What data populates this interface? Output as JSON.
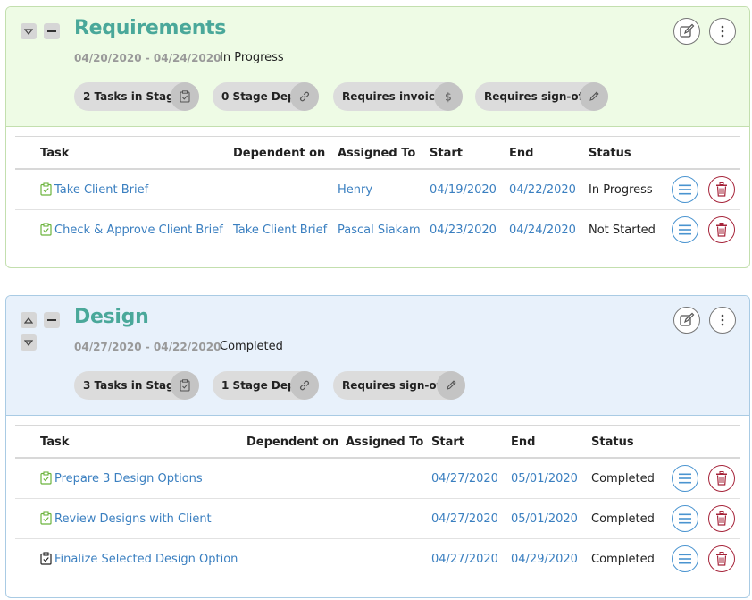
{
  "stages": [
    {
      "title": "Requirements",
      "dates": "04/20/2020 - 04/24/2020",
      "status": "In Progress",
      "pills": [
        {
          "count": "2",
          "label": "Tasks in Stage",
          "icon": "clipboard-check-icon"
        },
        {
          "count": "0",
          "label": "Stage Dep",
          "icon": "link-icon"
        },
        {
          "count": "",
          "label": "Requires invoice",
          "icon": "dollar-icon"
        },
        {
          "count": "",
          "label": "Requires sign-off",
          "icon": "pencil-icon"
        }
      ],
      "columns": [
        "Task",
        "Dependent on",
        "Assigned To",
        "Start",
        "End",
        "Status"
      ],
      "rows": [
        {
          "task": "Take Client Brief",
          "dependent": "",
          "assigned": "Henry",
          "start": "04/19/2020",
          "end": "04/22/2020",
          "status": "In Progress",
          "check_color": "#6bb33c"
        },
        {
          "task": "Check & Approve Client Brief",
          "dependent": "Take Client Brief",
          "assigned": "Pascal Siakam",
          "start": "04/23/2020",
          "end": "04/24/2020",
          "status": "Not Started",
          "check_color": "#6bb33c"
        }
      ]
    },
    {
      "title": "Design",
      "dates": "04/27/2020 - 04/22/2020",
      "status": "Completed",
      "pills": [
        {
          "count": "3",
          "label": "Tasks in Stage",
          "icon": "clipboard-check-icon"
        },
        {
          "count": "1",
          "label": "Stage Dep",
          "icon": "link-icon"
        },
        {
          "count": "",
          "label": "Requires sign-off",
          "icon": "pencil-icon"
        }
      ],
      "columns": [
        "Task",
        "Dependent on",
        "Assigned To",
        "Start",
        "End",
        "Status"
      ],
      "rows": [
        {
          "task": "Prepare 3 Design Options",
          "dependent": "",
          "assigned": "",
          "start": "04/27/2020",
          "end": "05/01/2020",
          "status": "Completed",
          "check_color": "#6bb33c"
        },
        {
          "task": "Review Designs with Client",
          "dependent": "",
          "assigned": "",
          "start": "04/27/2020",
          "end": "05/01/2020",
          "status": "Completed",
          "check_color": "#6bb33c"
        },
        {
          "task": "Finalize Selected Design Option",
          "dependent": "",
          "assigned": "",
          "start": "04/27/2020",
          "end": "04/29/2020",
          "status": "Completed",
          "check_color": "#222222"
        }
      ]
    }
  ],
  "colors": {
    "title": "#4aa89a",
    "link": "#3a7fc0",
    "menu_button": "#4a94d0",
    "delete_button": "#a6243a",
    "requirements_bg": "#eefbe5",
    "design_bg": "#e8f1fb"
  }
}
